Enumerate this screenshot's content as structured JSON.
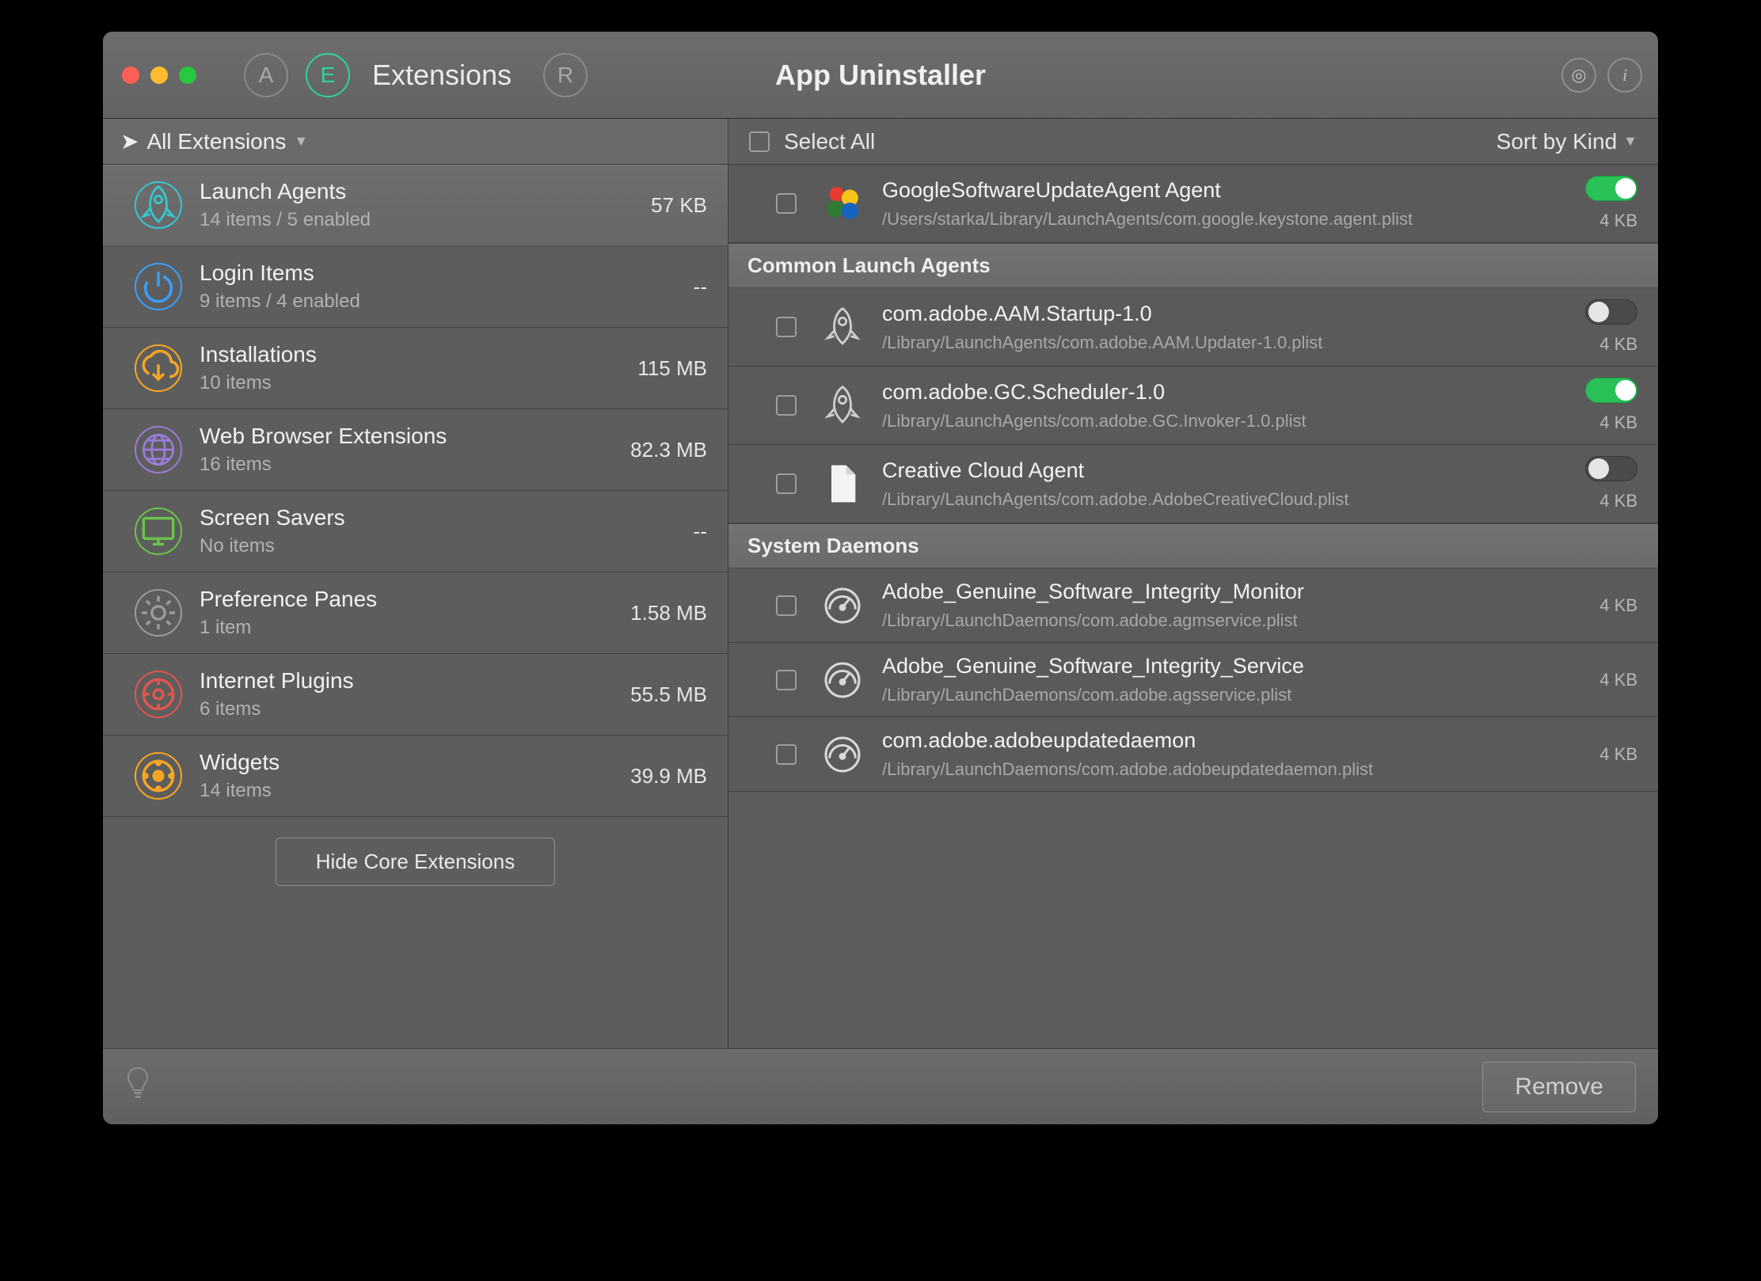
{
  "titlebar": {
    "tab_label": "Extensions",
    "app_title": "App Uninstaller"
  },
  "filter": {
    "left_label": "All Extensions",
    "select_all": "Select All",
    "sort_label": "Sort by Kind"
  },
  "sidebar": {
    "hide_button": "Hide Core Extensions",
    "categories": [
      {
        "id": "launch-agents",
        "title": "Launch Agents",
        "sub": "14 items / 5 enabled",
        "size": "57 KB",
        "icon": "rocket",
        "color": "#35c8d1",
        "selected": true
      },
      {
        "id": "login-items",
        "title": "Login Items",
        "sub": "9 items / 4 enabled",
        "size": "--",
        "icon": "power",
        "color": "#39a0ff",
        "selected": false
      },
      {
        "id": "installations",
        "title": "Installations",
        "sub": "10 items",
        "size": "115 MB",
        "icon": "download",
        "color": "#f6a624",
        "selected": false
      },
      {
        "id": "web-ext",
        "title": "Web Browser Extensions",
        "sub": "16 items",
        "size": "82.3 MB",
        "icon": "globe",
        "color": "#9a7bd5",
        "selected": false
      },
      {
        "id": "screen-savers",
        "title": "Screen Savers",
        "sub": "No items",
        "size": "--",
        "icon": "screen",
        "color": "#69c34a",
        "selected": false
      },
      {
        "id": "pref-panes",
        "title": "Preference Panes",
        "sub": "1 item",
        "size": "1.58 MB",
        "icon": "gear",
        "color": "#9a9a9a",
        "selected": false
      },
      {
        "id": "internet-plugins",
        "title": "Internet Plugins",
        "sub": "6 items",
        "size": "55.5 MB",
        "icon": "plug",
        "color": "#e0574e",
        "selected": false
      },
      {
        "id": "widgets",
        "title": "Widgets",
        "sub": "14 items",
        "size": "39.9 MB",
        "icon": "widget",
        "color": "#f6a624",
        "selected": false
      }
    ]
  },
  "main": {
    "sections": [
      {
        "header": null,
        "items": [
          {
            "title": "GoogleSoftwareUpdateAgent Agent",
            "path": "/Users/starka/Library/LaunchAgents/com.google.keystone.agent.plist",
            "size": "4 KB",
            "enabled": true,
            "icon": "balls"
          }
        ]
      },
      {
        "header": "Common Launch Agents",
        "items": [
          {
            "title": "com.adobe.AAM.Startup-1.0",
            "path": "/Library/LaunchAgents/com.adobe.AAM.Updater-1.0.plist",
            "size": "4 KB",
            "enabled": false,
            "icon": "rocket"
          },
          {
            "title": "com.adobe.GC.Scheduler-1.0",
            "path": "/Library/LaunchAgents/com.adobe.GC.Invoker-1.0.plist",
            "size": "4 KB",
            "enabled": true,
            "icon": "rocket"
          },
          {
            "title": "Creative Cloud Agent",
            "path": "/Library/LaunchAgents/com.adobe.AdobeCreativeCloud.plist",
            "size": "4 KB",
            "enabled": false,
            "icon": "doc"
          }
        ]
      },
      {
        "header": "System Daemons",
        "items": [
          {
            "title": "Adobe_Genuine_Software_Integrity_Monitor",
            "path": "/Library/LaunchDaemons/com.adobe.agmservice.plist",
            "size": "4 KB",
            "enabled": null,
            "icon": "gauge"
          },
          {
            "title": "Adobe_Genuine_Software_Integrity_Service",
            "path": "/Library/LaunchDaemons/com.adobe.agsservice.plist",
            "size": "4 KB",
            "enabled": null,
            "icon": "gauge"
          },
          {
            "title": "com.adobe.adobeupdatedaemon",
            "path": "/Library/LaunchDaemons/com.adobe.adobeupdatedaemon.plist",
            "size": "4 KB",
            "enabled": null,
            "icon": "gauge"
          }
        ]
      }
    ]
  },
  "footer": {
    "remove_label": "Remove"
  },
  "colors": {
    "accent_green": "#29c158",
    "accent_teal": "#2dd4a0"
  }
}
